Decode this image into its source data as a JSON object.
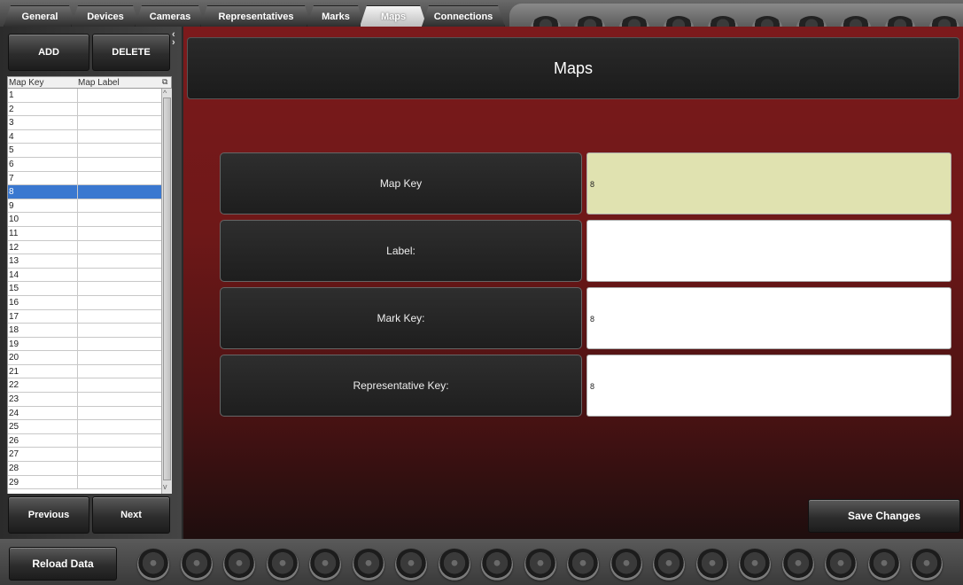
{
  "tabs": [
    {
      "label": "General",
      "active": false
    },
    {
      "label": "Devices",
      "active": false
    },
    {
      "label": "Cameras",
      "active": false
    },
    {
      "label": "Representatives",
      "active": false
    },
    {
      "label": "Marks",
      "active": false
    },
    {
      "label": "Maps",
      "active": true
    },
    {
      "label": "Connections",
      "active": false
    }
  ],
  "left": {
    "add_label": "ADD",
    "delete_label": "DELETE",
    "col_key": "Map Key",
    "col_label": "Map Label",
    "rows": [
      "1",
      "2",
      "3",
      "4",
      "5",
      "6",
      "7",
      "8",
      "9",
      "10",
      "11",
      "12",
      "13",
      "14",
      "15",
      "16",
      "17",
      "18",
      "19",
      "20",
      "21",
      "22",
      "23",
      "24",
      "25",
      "26",
      "27",
      "28",
      "29"
    ],
    "selected_row": "8",
    "prev_label": "Previous",
    "next_label": "Next"
  },
  "main": {
    "title": "Maps",
    "fields": [
      {
        "label": "Map Key",
        "value": "8"
      },
      {
        "label": "Label:",
        "value": ""
      },
      {
        "label": "Mark Key:",
        "value": "8"
      },
      {
        "label": "Representative Key:",
        "value": "8"
      }
    ],
    "save_label": "Save Changes"
  },
  "bottom": {
    "reload_label": "Reload Data"
  },
  "colors": {
    "accent_red": "#7c1a1c",
    "selection_blue": "#3a78d0",
    "highlight_field": "#e0e2b0"
  }
}
